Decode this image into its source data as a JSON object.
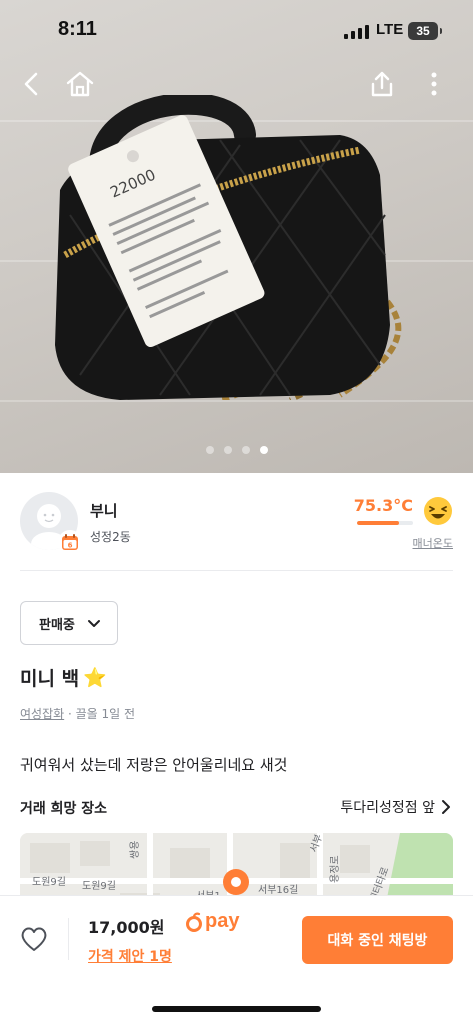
{
  "status_bar": {
    "time": "8:11",
    "network": "LTE",
    "battery": "35"
  },
  "nav": {
    "back_icon": "chevron-left-icon",
    "home_icon": "home-icon",
    "share_icon": "share-icon",
    "more_icon": "more-vertical-icon"
  },
  "photo": {
    "tag_price": "22000",
    "carousel_count": 4,
    "carousel_active_index": 3
  },
  "seller": {
    "name": "부니",
    "location": "성정2동",
    "temperature": "75.3°C",
    "temperature_level_percent": 75.3,
    "manner_label": "매너온도",
    "badge_number": "6"
  },
  "status_select": {
    "value": "판매중"
  },
  "product": {
    "title": "미니 백",
    "title_emoji": "⭐",
    "category": "여성잡화",
    "time": "· 끌올 1일 전",
    "description": "귀여워서 샀는데 저랑은 안어울리네요 새것"
  },
  "meeting": {
    "label": "거래 희망 장소",
    "place": "투다리성정점 앞"
  },
  "map": {
    "labels": [
      "도원9길",
      "도원9길",
      "서부16길",
      "서부1",
      "쌍용",
      "용정로",
      "센터타로",
      "서부"
    ]
  },
  "bottom": {
    "price": "17,000원",
    "pay_label": "pay",
    "offer": "가격 제안 1명",
    "chat_button": "대화 중인 채팅방"
  },
  "colors": {
    "accent": "#ff7e36"
  }
}
